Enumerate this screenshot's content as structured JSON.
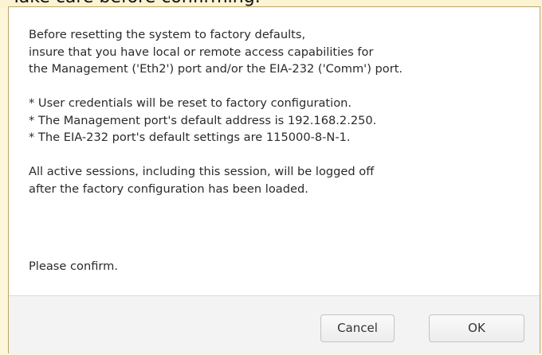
{
  "window": {
    "title": "Take care before confirming."
  },
  "dialog": {
    "intro_lines": [
      "Before resetting the system to factory defaults,",
      "insure that you have local or remote access capabilities for",
      "the Management ('Eth2') port and/or the EIA-232 ('Comm') port."
    ],
    "bullet_lines": [
      "* User credentials will be reset to factory configuration.",
      "* The Management port's default address is 192.168.2.250.",
      "* The EIA-232 port's default settings are 115000-8-N-1."
    ],
    "session_lines": [
      "All active sessions, including this session, will be logged off",
      "after the factory configuration has been loaded."
    ],
    "confirm_text": "Please confirm.",
    "cancel_label": "Cancel",
    "ok_label": "OK"
  }
}
